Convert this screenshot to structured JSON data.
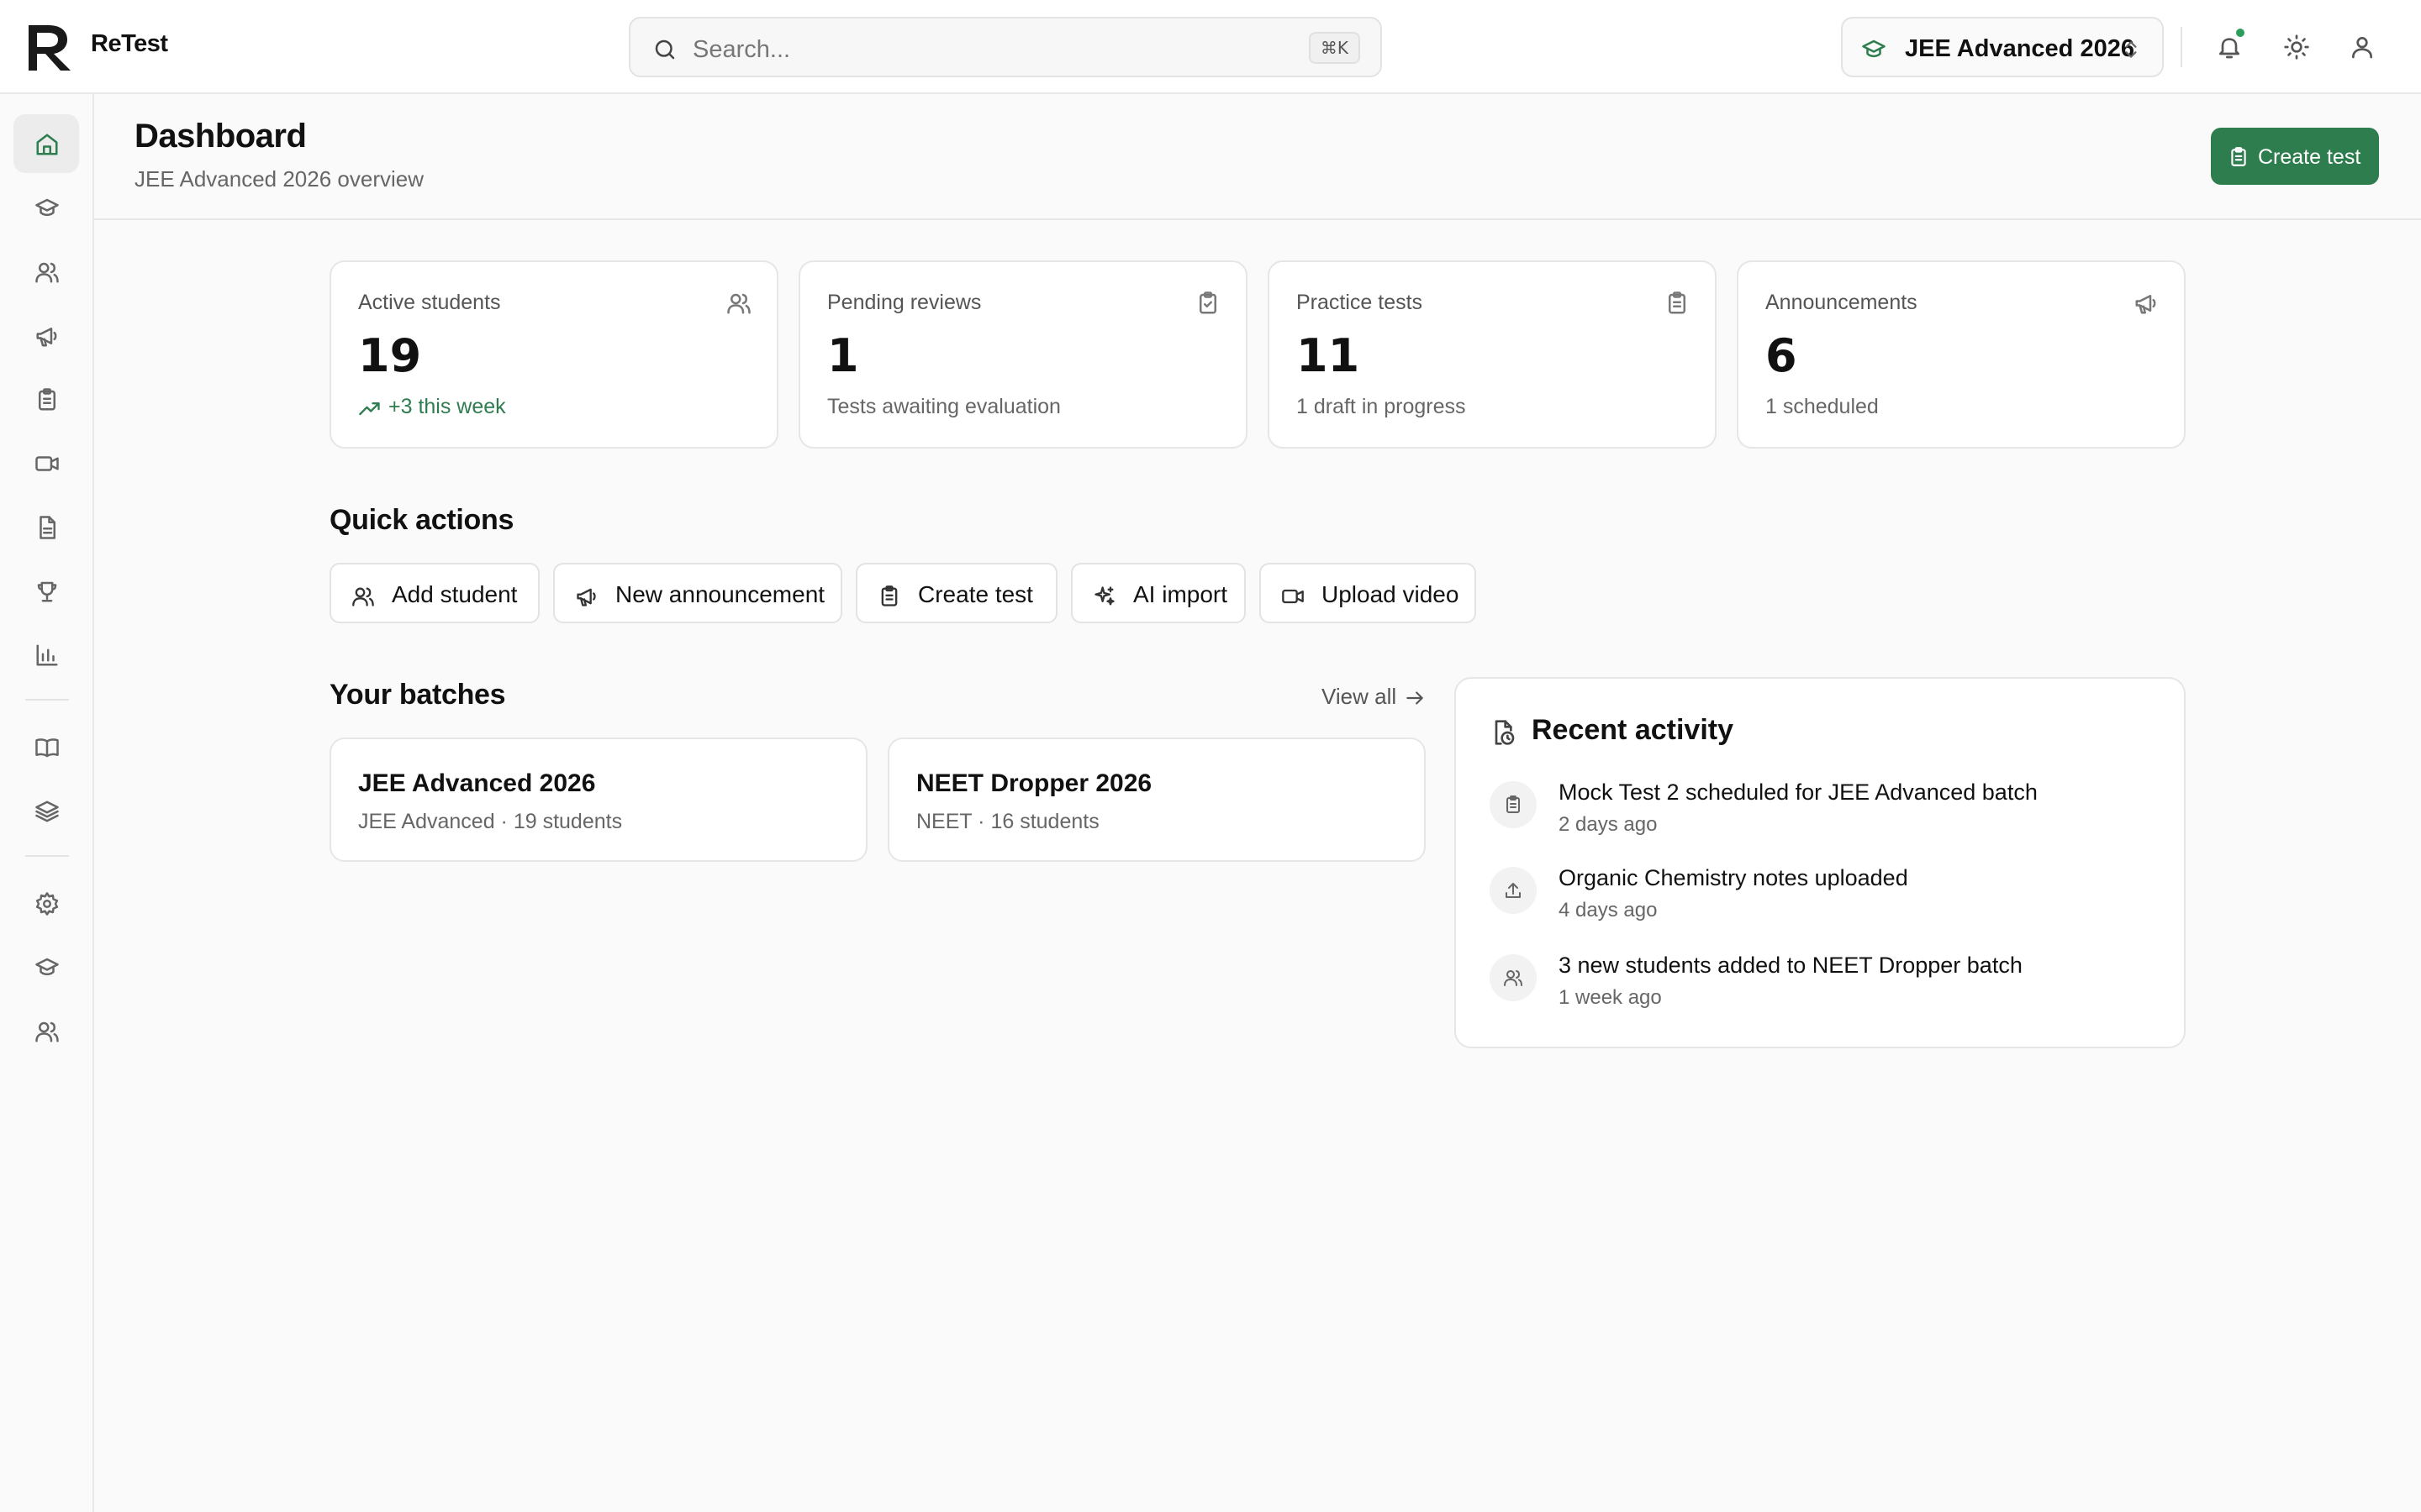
{
  "app": {
    "name": "ReTest"
  },
  "search": {
    "placeholder": "Search...",
    "shortcut": "⌘K"
  },
  "batch_selector": {
    "label": "JEE Advanced 2026"
  },
  "colors": {
    "accent": "#2e7d4f",
    "notification_dot": "#2e9c5a"
  },
  "sidebar": {
    "items": [
      {
        "name": "home",
        "icon": "home-icon",
        "active": true
      },
      {
        "name": "batches",
        "icon": "graduation-cap-icon"
      },
      {
        "name": "students",
        "icon": "users-icon"
      },
      {
        "name": "announcements",
        "icon": "megaphone-icon"
      },
      {
        "name": "tests",
        "icon": "clipboard-icon"
      },
      {
        "name": "videos",
        "icon": "video-icon"
      },
      {
        "name": "notes",
        "icon": "file-text-icon"
      },
      {
        "name": "leaderboard",
        "icon": "trophy-icon"
      },
      {
        "name": "analytics",
        "icon": "bar-chart-icon"
      },
      {
        "name": "library",
        "icon": "book-open-icon"
      },
      {
        "name": "question-bank",
        "icon": "layers-icon"
      },
      {
        "name": "settings",
        "icon": "gear-icon"
      },
      {
        "name": "institute",
        "icon": "graduation-cap-icon"
      },
      {
        "name": "team",
        "icon": "users-icon"
      }
    ]
  },
  "header": {
    "title": "Dashboard",
    "subtitle": "JEE Advanced 2026 overview",
    "create_button": "Create test"
  },
  "stats": [
    {
      "label": "Active students",
      "value": "19",
      "sub": "+3 this week",
      "icon": "users-icon",
      "trend": "up"
    },
    {
      "label": "Pending reviews",
      "value": "1",
      "sub": "Tests awaiting evaluation",
      "icon": "clipboard-check-icon"
    },
    {
      "label": "Practice tests",
      "value": "11",
      "sub": "1 draft in progress",
      "icon": "clipboard-icon"
    },
    {
      "label": "Announcements",
      "value": "6",
      "sub": "1 scheduled",
      "icon": "megaphone-icon"
    }
  ],
  "quick_actions": {
    "title": "Quick actions",
    "items": [
      {
        "label": "Add student",
        "icon": "users-icon"
      },
      {
        "label": "New announcement",
        "icon": "megaphone-icon"
      },
      {
        "label": "Create test",
        "icon": "clipboard-icon"
      },
      {
        "label": "AI import",
        "icon": "sparkles-icon"
      },
      {
        "label": "Upload video",
        "icon": "video-icon"
      }
    ]
  },
  "batches": {
    "title": "Your batches",
    "view_all": "View all",
    "items": [
      {
        "name": "JEE Advanced 2026",
        "meta": "JEE Advanced · 19 students"
      },
      {
        "name": "NEET Dropper 2026",
        "meta": "NEET · 16 students"
      }
    ]
  },
  "activity": {
    "title": "Recent activity",
    "items": [
      {
        "text": "Mock Test 2 scheduled for JEE Advanced batch",
        "time": "2 days ago",
        "icon": "clipboard-icon"
      },
      {
        "text": "Organic Chemistry notes uploaded",
        "time": "4 days ago",
        "icon": "upload-icon"
      },
      {
        "text": "3 new students added to NEET Dropper batch",
        "time": "1 week ago",
        "icon": "users-icon"
      }
    ]
  }
}
